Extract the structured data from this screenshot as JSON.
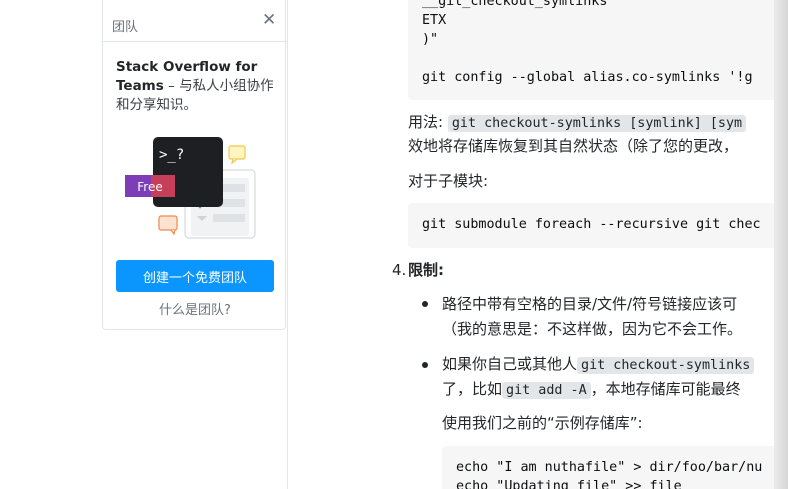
{
  "teams": {
    "title": "团队",
    "close_glyph": "✕",
    "heading_bold": "Stack Overflow for Teams",
    "heading_rest": " – 与私人小组协作和分享知识。",
    "terminal_prompt": ">_?",
    "free_badge": "Free",
    "create_button": "创建一个免费团队",
    "what_link": "什么是团队?"
  },
  "code_top": {
    "lines": [
      "__git_checkout_symlinks",
      "ETX",
      ")\"",
      "",
      "git config --global alias.co-symlinks '!g"
    ]
  },
  "usage": {
    "prefix": "用法:",
    "code": "git checkout-symlinks [symlink] [sym",
    "line2": "效地将存储库恢复到其自然状态（除了您的更改，"
  },
  "submodule": {
    "label": "对于子模块:",
    "code": "git submodule foreach --recursive git chec"
  },
  "limits": {
    "number": "4.",
    "title": "限制:",
    "bullet1_line1": "路径中带有空格的目录/文件/符号链接应该可",
    "bullet1_line2": "（我的意思是：不这样做，因为它不会工作。",
    "bullet2_line1_pre": "如果你自己或其他人",
    "bullet2_line1_code": "git checkout-symlinks",
    "bullet2_line2_pre": "了，比如",
    "bullet2_line2_code": "git add -A",
    "bullet2_line2_post": "，本地存储库可能最终",
    "example_label": "使用我们之前的“示例存储库”:"
  },
  "code_bottom": {
    "lines": [
      "echo \"I am nuthafile\" > dir/foo/bar/nu",
      "echo \"Updating file\" >> file"
    ]
  }
}
